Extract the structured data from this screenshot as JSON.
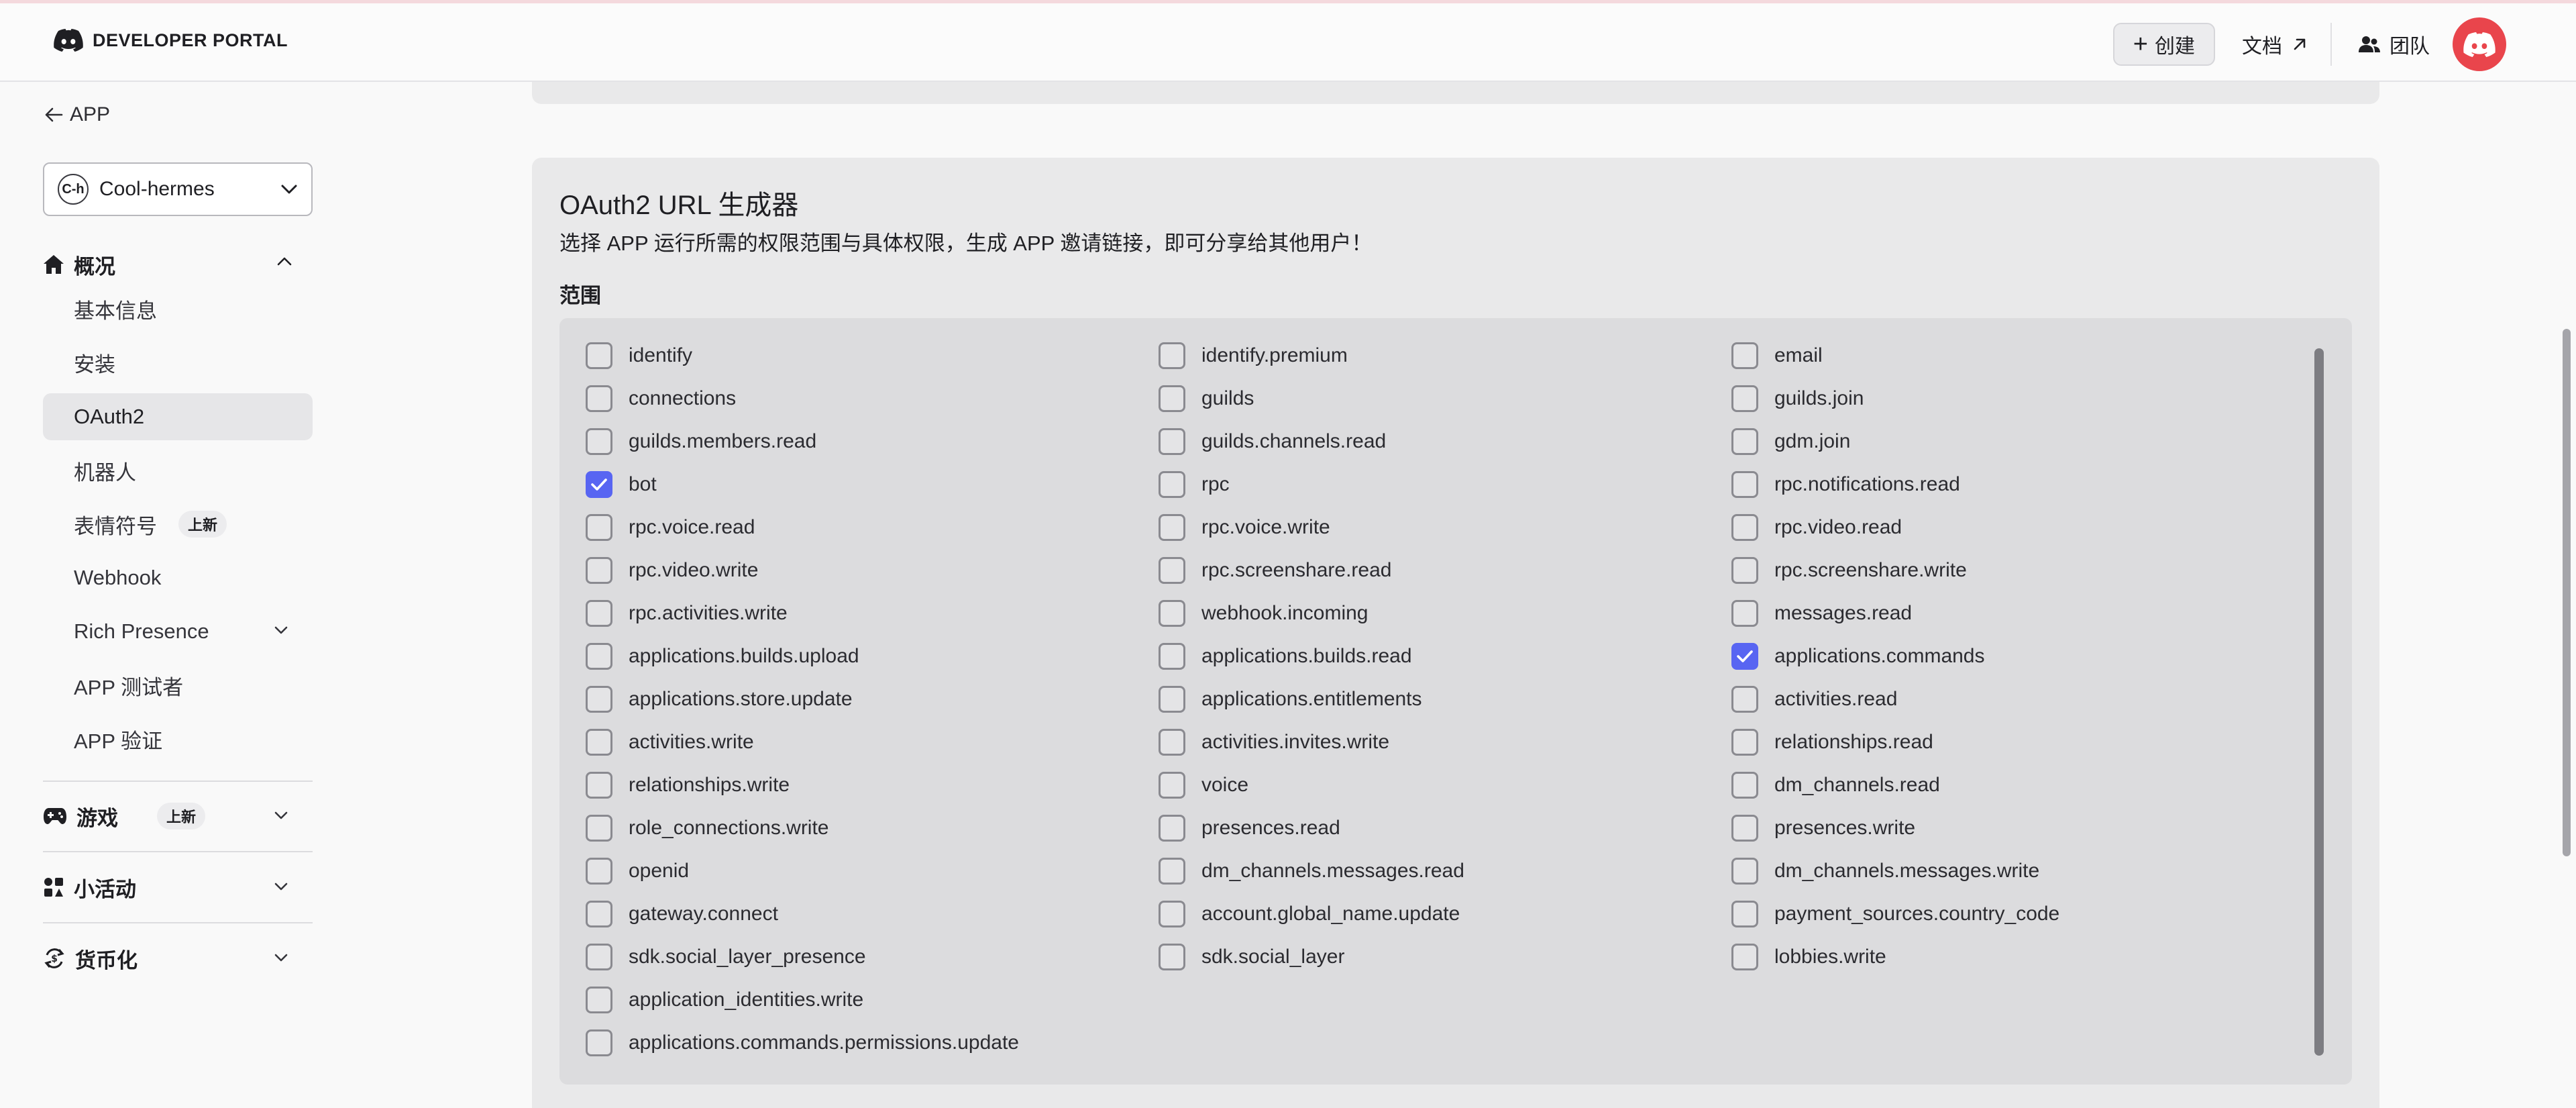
{
  "header": {
    "logo_text": "DEVELOPER PORTAL",
    "create_label": "创建",
    "docs_label": "文档",
    "team_label": "团队",
    "accent_color": "#e9454c"
  },
  "sidebar": {
    "back_label": "APP",
    "app": {
      "avatar_text": "C-h",
      "name": "Cool-hermes"
    },
    "overview_label": "概况",
    "items": [
      {
        "label": "基本信息"
      },
      {
        "label": "安装"
      },
      {
        "label": "OAuth2",
        "active": true
      },
      {
        "label": "机器人"
      },
      {
        "label": "表情符号",
        "badge": "上新"
      },
      {
        "label": "Webhook"
      },
      {
        "label": "Rich Presence"
      },
      {
        "label": "APP 测试者"
      },
      {
        "label": "APP 验证"
      }
    ],
    "sections": [
      {
        "label": "游戏",
        "badge": "上新",
        "icon": "gamepad-icon"
      },
      {
        "label": "小活动",
        "icon": "activities-icon"
      },
      {
        "label": "货币化",
        "icon": "monetization-icon"
      }
    ]
  },
  "oauth": {
    "title": "OAuth2 URL 生成器",
    "description": "选择 APP 运行所需的权限范围与具体权限，生成 APP 邀请链接，即可分享给其他用户！",
    "scopes_label": "范围",
    "check_color": "#5865f2",
    "scopes": {
      "col1": [
        {
          "name": "identify",
          "checked": false
        },
        {
          "name": "connections",
          "checked": false
        },
        {
          "name": "guilds.members.read",
          "checked": false
        },
        {
          "name": "bot",
          "checked": true
        },
        {
          "name": "rpc.voice.read",
          "checked": false
        },
        {
          "name": "rpc.video.write",
          "checked": false
        },
        {
          "name": "rpc.activities.write",
          "checked": false
        },
        {
          "name": "applications.builds.upload",
          "checked": false
        },
        {
          "name": "applications.store.update",
          "checked": false
        },
        {
          "name": "activities.write",
          "checked": false
        },
        {
          "name": "relationships.write",
          "checked": false
        },
        {
          "name": "role_connections.write",
          "checked": false
        },
        {
          "name": "openid",
          "checked": false
        },
        {
          "name": "gateway.connect",
          "checked": false
        },
        {
          "name": "sdk.social_layer_presence",
          "checked": false
        },
        {
          "name": "application_identities.write",
          "checked": false
        },
        {
          "name": "applications.commands.permissions.update",
          "checked": false
        }
      ],
      "col2": [
        {
          "name": "identify.premium",
          "checked": false
        },
        {
          "name": "guilds",
          "checked": false
        },
        {
          "name": "guilds.channels.read",
          "checked": false
        },
        {
          "name": "rpc",
          "checked": false
        },
        {
          "name": "rpc.voice.write",
          "checked": false
        },
        {
          "name": "rpc.screenshare.read",
          "checked": false
        },
        {
          "name": "webhook.incoming",
          "checked": false
        },
        {
          "name": "applications.builds.read",
          "checked": false
        },
        {
          "name": "applications.entitlements",
          "checked": false
        },
        {
          "name": "activities.invites.write",
          "checked": false
        },
        {
          "name": "voice",
          "checked": false
        },
        {
          "name": "presences.read",
          "checked": false
        },
        {
          "name": "dm_channels.messages.read",
          "checked": false
        },
        {
          "name": "account.global_name.update",
          "checked": false
        },
        {
          "name": "sdk.social_layer",
          "checked": false
        }
      ],
      "col3": [
        {
          "name": "email",
          "checked": false
        },
        {
          "name": "guilds.join",
          "checked": false
        },
        {
          "name": "gdm.join",
          "checked": false
        },
        {
          "name": "rpc.notifications.read",
          "checked": false
        },
        {
          "name": "rpc.video.read",
          "checked": false
        },
        {
          "name": "rpc.screenshare.write",
          "checked": false
        },
        {
          "name": "messages.read",
          "checked": false
        },
        {
          "name": "applications.commands",
          "checked": true
        },
        {
          "name": "activities.read",
          "checked": false
        },
        {
          "name": "relationships.read",
          "checked": false
        },
        {
          "name": "dm_channels.read",
          "checked": false
        },
        {
          "name": "presences.write",
          "checked": false
        },
        {
          "name": "dm_channels.messages.write",
          "checked": false
        },
        {
          "name": "payment_sources.country_code",
          "checked": false
        },
        {
          "name": "lobbies.write",
          "checked": false
        }
      ]
    }
  }
}
